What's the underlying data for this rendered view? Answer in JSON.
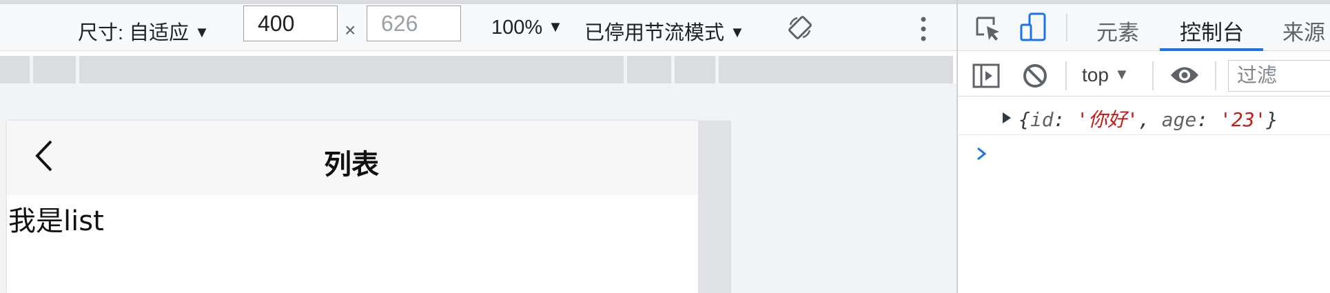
{
  "device_toolbar": {
    "dimensions_label": "尺寸: 自适应",
    "width_value": "400",
    "times_symbol": "×",
    "height_value": "626",
    "zoom_label": "100%",
    "throttle_label": "已停用节流模式"
  },
  "devtools": {
    "tabs": [
      "元素",
      "控制台",
      "来源"
    ],
    "active_tab": "控制台",
    "context": "top",
    "filter_placeholder": "过滤",
    "log": {
      "open": "{",
      "key1": "id",
      "val1": "'你好'",
      "key2": "age",
      "val2": "'23'",
      "close": "}"
    }
  },
  "page": {
    "nav_title": "列表",
    "body_text": "我是list"
  },
  "colors": {
    "accent": "#1a73e8",
    "string": "#c41a16"
  }
}
